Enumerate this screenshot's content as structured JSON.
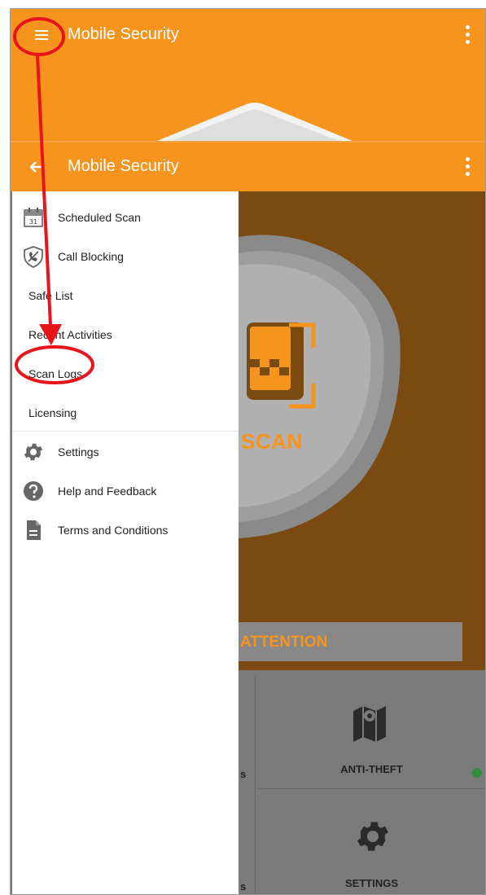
{
  "app": {
    "title": "Mobile Security",
    "accent_color": "#f7941d"
  },
  "drawer": {
    "items": [
      {
        "label": "Scheduled Scan",
        "icon": "calendar-icon"
      },
      {
        "label": "Call Blocking",
        "icon": "call-block-shield-icon"
      },
      {
        "label": "Safe List"
      },
      {
        "label": "Recent Activities"
      },
      {
        "label": "Scan Logs"
      },
      {
        "label": "Licensing"
      }
    ],
    "secondary": [
      {
        "label": "Settings",
        "icon": "gear-icon"
      },
      {
        "label": "Help and Feedback",
        "icon": "help-icon"
      },
      {
        "label": "Terms and Conditions",
        "icon": "document-icon"
      }
    ]
  },
  "main": {
    "scan_label": "SCAN",
    "attention_label": "ATTENTION",
    "tiles": [
      {
        "label": "ANTI-THEFT",
        "icon": "map-pin-icon"
      },
      {
        "label": "SETTINGS",
        "icon": "gear-icon"
      }
    ]
  },
  "calendar_day": "31"
}
